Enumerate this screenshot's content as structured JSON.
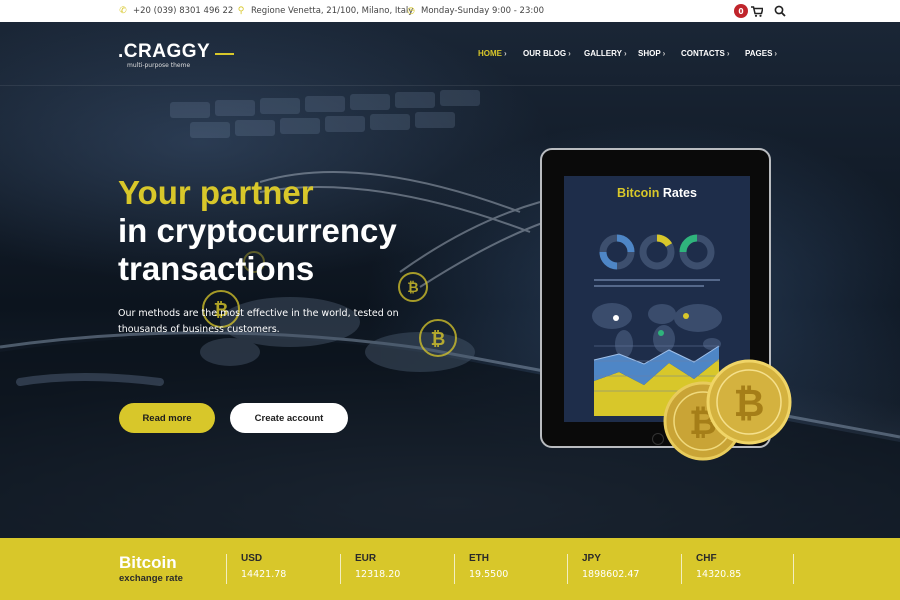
{
  "topbar": {
    "phone": "+20 (039) 8301 496 22",
    "address": "Regione Venetta, 21/100, Milano, Italy",
    "hours": "Monday-Sunday 9:00 - 23:00",
    "cart_count": "0",
    "icons": [
      "phone-icon",
      "map-pin-icon",
      "clock-icon",
      "cart-icon",
      "search-icon"
    ]
  },
  "header": {
    "logo": ".CRAGGY",
    "tagline": "multi-purpose theme",
    "nav": [
      {
        "label": "HOME",
        "active": true
      },
      {
        "label": "OUR BLOG",
        "active": false
      },
      {
        "label": "GALLERY",
        "active": false
      },
      {
        "label": "SHOP",
        "active": false
      },
      {
        "label": "CONTACTS",
        "active": false
      },
      {
        "label": "PAGES",
        "active": false
      }
    ]
  },
  "hero": {
    "title_line1": "Your partner",
    "title_line2": "in cryptocurrency",
    "title_line3": "transactions",
    "subtitle": "Our methods are the most effective in the world, tested on thousands of business customers.",
    "btn_read_more": "Read more",
    "btn_create_account": "Create account"
  },
  "tablet": {
    "title_part1": "Bitcoin",
    "title_part2": " Rates"
  },
  "rates": {
    "title": "Bitcoin",
    "subtitle": "exchange rate",
    "items": [
      {
        "code": "USD",
        "value": "14421.78"
      },
      {
        "code": "EUR",
        "value": "12318.20"
      },
      {
        "code": "ETH",
        "value": "19.5500"
      },
      {
        "code": "JPY",
        "value": "1898602.47"
      },
      {
        "code": "CHF",
        "value": "14320.85"
      }
    ]
  },
  "colors": {
    "accent": "#d8c72a",
    "badge": "#c0242b",
    "dark_bg": "#0f1823"
  }
}
